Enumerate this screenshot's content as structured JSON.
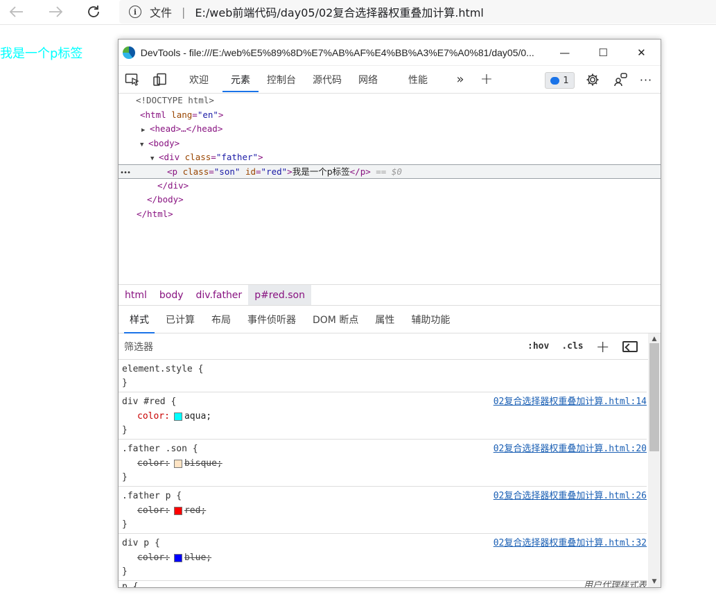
{
  "browser": {
    "file_label": "文件",
    "separator": "|",
    "url": "E:/web前端代码/day05/02复合选择器权重叠加计算.html"
  },
  "page": {
    "text": "我是一个p标签",
    "text_color": "#00ffff"
  },
  "devtools": {
    "title": "DevTools - file:///E:/web%E5%89%8D%E7%AB%AF%E4%BB%A3%E7%A0%81/day05/0...",
    "window_controls": {
      "minimize": "—",
      "maximize": "☐",
      "close": "✕"
    },
    "tabs": [
      {
        "label": "欢迎"
      },
      {
        "label": "元素",
        "active": true
      },
      {
        "label": "控制台"
      },
      {
        "label": "源代码"
      },
      {
        "label": "网络"
      },
      {
        "label": "性能"
      }
    ],
    "more_tabs": "»",
    "add_tab": "+",
    "issues_count": "1",
    "more_menu": "···",
    "dom": {
      "doctype": "<!DOCTYPE html>",
      "html_open_tag": "<html",
      "html_attr_name": "lang",
      "html_attr_value": "\"en\"",
      "head_tag": "<head>…</head>",
      "body_open": "<body>",
      "div_open_tag": "<div",
      "div_attr_name": "class",
      "div_attr_value": "\"father\"",
      "p_open_tag": "<p",
      "p_attr1_name": "class",
      "p_attr1_value": "\"son\"",
      "p_attr2_name": "id",
      "p_attr2_value": "\"red\"",
      "p_text": "我是一个p标签",
      "p_close": "</p>",
      "selected_marker": "== $0",
      "ellipsis": "•••",
      "div_close": "</div>",
      "body_close": "</body>",
      "html_close": "</html>"
    },
    "breadcrumbs": [
      "html",
      "body",
      "div.father",
      "p#red.son"
    ],
    "subtabs": [
      "样式",
      "已计算",
      "布局",
      "事件侦听器",
      "DOM 断点",
      "属性",
      "辅助功能"
    ],
    "filter": {
      "placeholder": "筛选器",
      "hov": ":hov",
      "cls": ".cls",
      "add": "+"
    },
    "rules": [
      {
        "selector": "element.style {",
        "source": "",
        "declarations": [],
        "close": "}"
      },
      {
        "selector": "div #red {",
        "source": "02复合选择器权重叠加计算.html:14",
        "close": "}",
        "declarations": [
          {
            "name": "color:",
            "value": "aqua;",
            "swatch": "#00ffff",
            "overridden": false
          }
        ]
      },
      {
        "selector": ".father .son {",
        "source": "02复合选择器权重叠加计算.html:20",
        "close": "}",
        "declarations": [
          {
            "name": "color:",
            "value": "bisque;",
            "swatch": "#ffe4c4",
            "overridden": true
          }
        ]
      },
      {
        "selector": ".father p {",
        "source": "02复合选择器权重叠加计算.html:26",
        "close": "}",
        "declarations": [
          {
            "name": "color:",
            "value": "red;",
            "swatch": "#ff0000",
            "overridden": true
          }
        ]
      },
      {
        "selector": "div p {",
        "source": "02复合选择器权重叠加计算.html:32",
        "close": "}",
        "declarations": [
          {
            "name": "color:",
            "value": "blue;",
            "swatch": "#0000ff",
            "overridden": true
          }
        ]
      },
      {
        "selector": "p {",
        "source": "用户代理样式表",
        "declarations": [],
        "close": ""
      }
    ]
  }
}
